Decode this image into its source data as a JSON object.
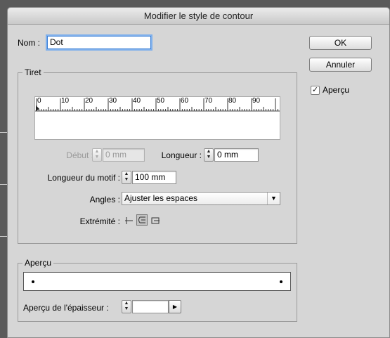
{
  "dialog": {
    "title": "Modifier le style de contour"
  },
  "name_field": {
    "label": "Nom :",
    "value": "Dot"
  },
  "buttons": {
    "ok": "OK",
    "cancel": "Annuler"
  },
  "preview_checkbox": {
    "label": "Aperçu",
    "checked": true,
    "mark": "✓"
  },
  "dash_group": {
    "title": "Tiret",
    "ruler_ticks": [
      "0",
      "10",
      "20",
      "30",
      "40",
      "50",
      "60",
      "70",
      "80",
      "90"
    ],
    "start": {
      "label": "Début :",
      "value": "0 mm",
      "disabled": true
    },
    "length": {
      "label": "Longueur :",
      "value": "0 mm"
    },
    "pattern_length": {
      "label": "Longueur du motif :",
      "value": "100 mm"
    },
    "corners": {
      "label": "Angles :",
      "value": "Ajuster les espaces"
    },
    "cap": {
      "label": "Extrémité :",
      "options": [
        "butt-cap-icon",
        "round-cap-icon",
        "projecting-cap-icon"
      ],
      "selected_index": 1
    }
  },
  "preview_group": {
    "title": "Aperçu",
    "thickness": {
      "label": "Aperçu de l'épaisseur :",
      "value": ""
    }
  }
}
